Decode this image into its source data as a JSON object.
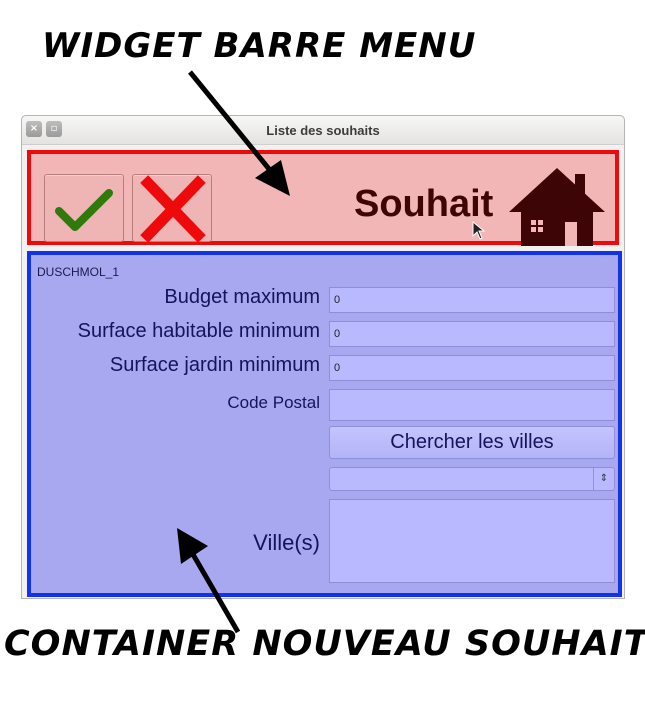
{
  "annotations": {
    "top": "WIDGET BARRE MENU",
    "bottom": "CONTAINER NOUVEAU SOUHAIT"
  },
  "window": {
    "title": "Liste des souhaits",
    "close_glyph": "×",
    "maximize_glyph": "▫"
  },
  "menubar": {
    "title": "Souhait",
    "validate_icon": "checkmark-icon",
    "cancel_icon": "cross-icon",
    "house_icon": "house-icon",
    "colors": {
      "background": "#f2b6b6",
      "border": "#ee0a0a",
      "check": "#2f7a0a",
      "cross": "#ee0a0a",
      "house": "#3d0505"
    }
  },
  "container": {
    "object_name": "DUSCHMOL_1",
    "colors": {
      "background": "#a8a8f0",
      "border": "#1232ec"
    },
    "fields": {
      "budget": {
        "label": "Budget maximum",
        "value": "0"
      },
      "surface_habitable": {
        "label": "Surface habitable minimum",
        "value": "0"
      },
      "surface_jardin": {
        "label": "Surface jardin minimum",
        "value": "0"
      },
      "code_postal": {
        "label": "Code Postal",
        "value": ""
      }
    },
    "search_button": "Chercher les villes",
    "combo": {
      "value": "",
      "arrow_glyph": "⇕"
    },
    "villes_label": "Ville(s)"
  }
}
